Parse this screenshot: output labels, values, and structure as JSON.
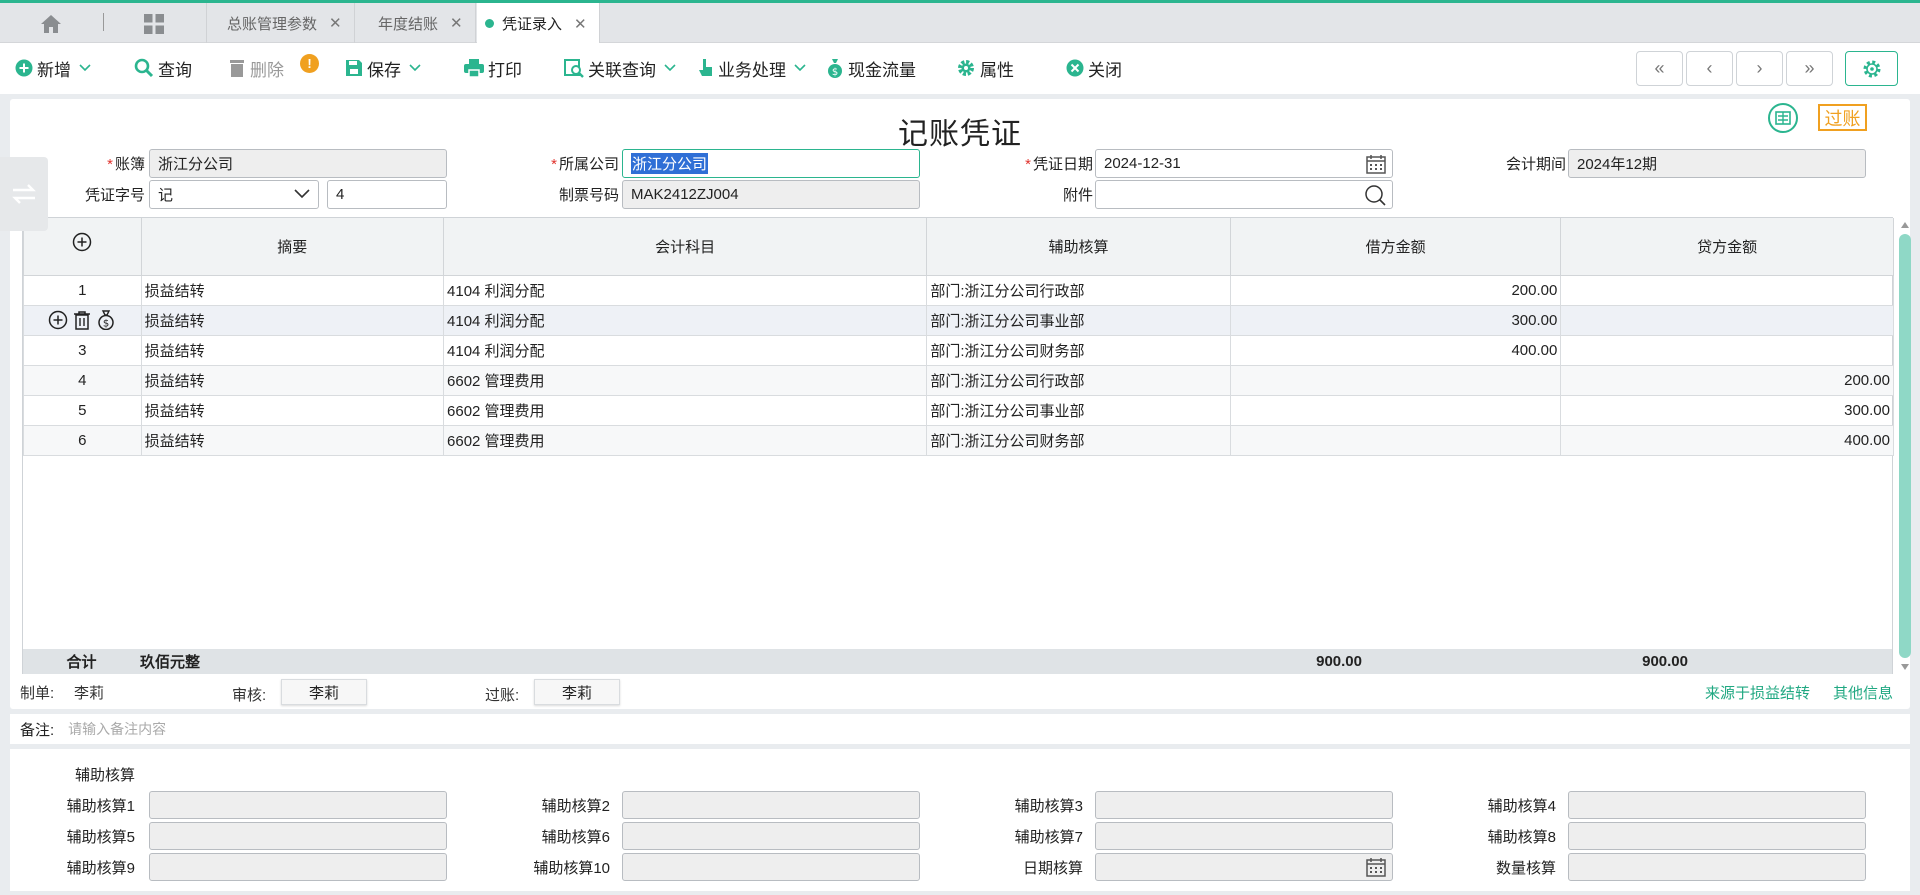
{
  "tabs": [
    {
      "label": "总账管理参数"
    },
    {
      "label": "年度结账"
    },
    {
      "label": "凭证录入"
    }
  ],
  "toolbar": {
    "add": "新增",
    "query": "查询",
    "delete": "删除",
    "save": "保存",
    "print": "打印",
    "related_query": "关联查询",
    "business": "业务处理",
    "cashflow": "现金流量",
    "properties": "属性",
    "close": "关闭"
  },
  "voucher": {
    "title": "记账凭证",
    "stamp": "过账",
    "ledger_label": "账簿",
    "ledger_value": "浙江分公司",
    "company_label": "所属公司",
    "company_value": "浙江分公司",
    "date_label": "凭证日期",
    "date_value": "2024-12-31",
    "period_label": "会计期间",
    "period_value": "2024年12期",
    "word_label": "凭证字号",
    "word_value": "记",
    "number_value": "4",
    "ticket_label": "制票号码",
    "ticket_value": "MAK2412ZJ004",
    "attach_label": "附件"
  },
  "grid": {
    "headers": {
      "summary": "摘要",
      "account": "会计科目",
      "aux": "辅助核算",
      "debit": "借方金额",
      "credit": "贷方金额"
    },
    "rows": [
      {
        "no": "1",
        "summary": "损益结转",
        "account": "4104 利润分配",
        "aux": "部门:浙江分公司行政部",
        "debit": "200.00",
        "credit": ""
      },
      {
        "no": "2",
        "summary": "损益结转",
        "account": "4104 利润分配",
        "aux": "部门:浙江分公司事业部",
        "debit": "300.00",
        "credit": ""
      },
      {
        "no": "3",
        "summary": "损益结转",
        "account": "4104 利润分配",
        "aux": "部门:浙江分公司财务部",
        "debit": "400.00",
        "credit": ""
      },
      {
        "no": "4",
        "summary": "损益结转",
        "account": "6602 管理费用",
        "aux": "部门:浙江分公司行政部",
        "debit": "",
        "credit": "200.00"
      },
      {
        "no": "5",
        "summary": "损益结转",
        "account": "6602 管理费用",
        "aux": "部门:浙江分公司事业部",
        "debit": "",
        "credit": "300.00"
      },
      {
        "no": "6",
        "summary": "损益结转",
        "account": "6602 管理费用",
        "aux": "部门:浙江分公司财务部",
        "debit": "",
        "credit": "400.00"
      }
    ],
    "total_label": "合计",
    "total_words": "玖佰元整",
    "total_debit": "900.00",
    "total_credit": "900.00"
  },
  "footer": {
    "maker_label": "制单:",
    "maker": "李莉",
    "audit_label": "审核:",
    "auditor": "李莉",
    "post_label": "过账:",
    "poster": "李莉",
    "source_link": "来源于损益结转",
    "other_link": "其他信息"
  },
  "remark": {
    "label": "备注:",
    "placeholder": "请输入备注内容"
  },
  "aux": {
    "section_label": "辅助核算",
    "fields": [
      "辅助核算1",
      "辅助核算2",
      "辅助核算3",
      "辅助核算4",
      "辅助核算5",
      "辅助核算6",
      "辅助核算7",
      "辅助核算8",
      "辅助核算9",
      "辅助核算10",
      "日期核算",
      "数量核算"
    ]
  },
  "colors": {
    "accent": "#2bb58f",
    "required": "#e0312c",
    "stamp": "#f0a020"
  }
}
